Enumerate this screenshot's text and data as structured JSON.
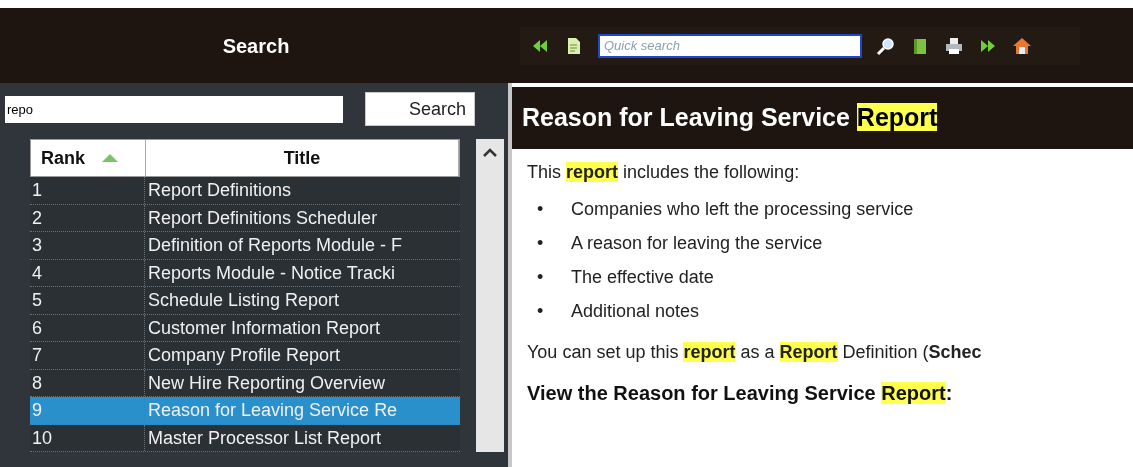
{
  "left_panel": {
    "title": "Search",
    "search": {
      "value": "repo",
      "button": "Search"
    },
    "table": {
      "columns": [
        {
          "label": "Rank",
          "sorted": true
        },
        {
          "label": "Title",
          "sorted": false
        }
      ],
      "rows": [
        {
          "rank": "1",
          "title": "Report Definitions",
          "selected": false
        },
        {
          "rank": "2",
          "title": "Report Definitions Scheduler",
          "selected": false
        },
        {
          "rank": "3",
          "title": "Definition of Reports Module - F",
          "selected": false
        },
        {
          "rank": "4",
          "title": "Reports Module - Notice Tracki",
          "selected": false
        },
        {
          "rank": "5",
          "title": "Schedule Listing Report",
          "selected": false
        },
        {
          "rank": "6",
          "title": "Customer Information Report",
          "selected": false
        },
        {
          "rank": "7",
          "title": "Company Profile Report",
          "selected": false
        },
        {
          "rank": "8",
          "title": "New Hire Reporting Overview",
          "selected": false
        },
        {
          "rank": "9",
          "title": "Reason for Leaving Service Re",
          "selected": true
        },
        {
          "rank": "10",
          "title": "Master Processor List Report",
          "selected": false
        }
      ]
    }
  },
  "toolbar": {
    "quick_search": {
      "placeholder": "Quick search"
    }
  },
  "article": {
    "title": [
      {
        "text": "Reason for Leaving Service ",
        "highlighted": false
      },
      {
        "text": "Report",
        "highlighted": true
      }
    ],
    "intro": [
      {
        "text": "This ",
        "bold": false,
        "highlighted": false
      },
      {
        "text": "report",
        "bold": true,
        "highlighted": true
      },
      {
        "text": " includes the following:",
        "bold": false,
        "highlighted": false
      }
    ],
    "bullets": [
      {
        "marker": "•",
        "text": "Companies who left the processing service"
      },
      {
        "marker": "•",
        "text": "A reason for leaving the service"
      },
      {
        "marker": "•",
        "text": "The effective date"
      },
      {
        "marker": "•",
        "text": "Additional notes"
      }
    ],
    "note": [
      {
        "text": "You can set up this ",
        "bold": false,
        "highlighted": false
      },
      {
        "text": "report",
        "bold": true,
        "highlighted": true
      },
      {
        "text": " as a ",
        "bold": false,
        "highlighted": false
      },
      {
        "text": "Report",
        "bold": true,
        "highlighted": true
      },
      {
        "text": " Definition (",
        "bold": false,
        "highlighted": false
      },
      {
        "text": "Schec",
        "bold": true,
        "highlighted": false
      }
    ],
    "subheading": [
      {
        "text": "View the Reason for Leaving Service ",
        "highlighted": false
      },
      {
        "text": "Report",
        "highlighted": true
      },
      {
        "text": ":",
        "highlighted": false
      }
    ]
  }
}
